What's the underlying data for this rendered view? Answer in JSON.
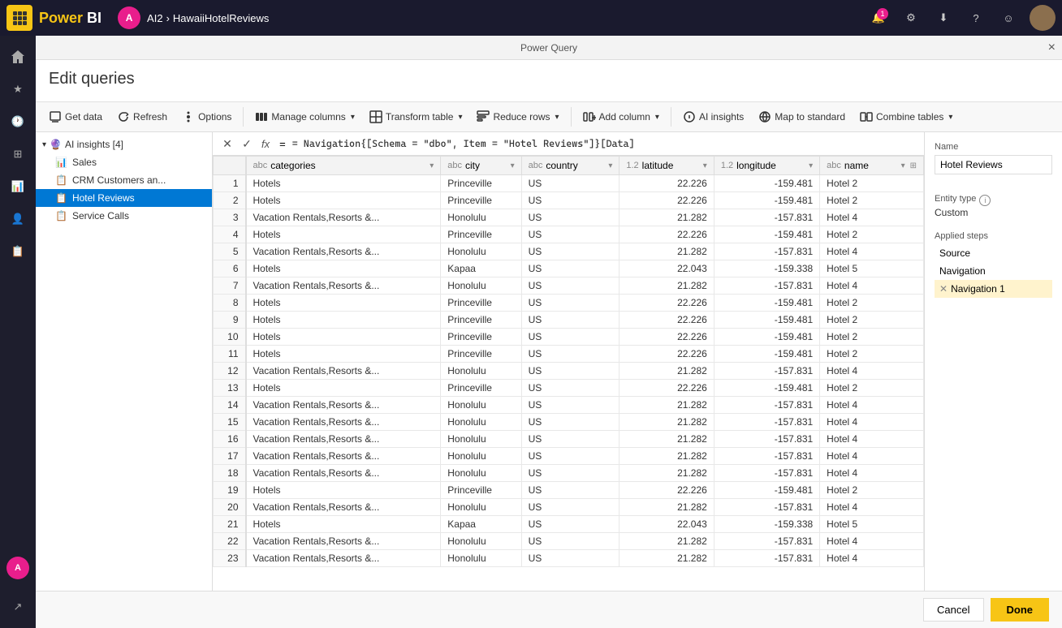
{
  "topbar": {
    "logo": "Power BI",
    "breadcrumb": [
      "A",
      "AI2",
      "HawaiiHotelReviews"
    ],
    "notification_count": "1",
    "dialog_title": "Power Query",
    "close_label": "×"
  },
  "edit_queries": {
    "title": "Edit queries"
  },
  "toolbar": {
    "get_data": "Get data",
    "refresh": "Refresh",
    "options": "Options",
    "manage_columns": "Manage columns",
    "transform_table": "Transform table",
    "reduce_rows": "Reduce rows",
    "add_column": "Add column",
    "ai_insights": "AI insights",
    "map_to_standard": "Map to standard",
    "combine_tables": "Combine tables"
  },
  "queries_panel": {
    "group": {
      "name": "AI insights [4]",
      "items": [
        {
          "label": "Sales",
          "type": "table",
          "active": false
        },
        {
          "label": "CRM Customers an...",
          "type": "table",
          "active": false
        },
        {
          "label": "Hotel Reviews",
          "type": "table",
          "active": true
        },
        {
          "label": "Service Calls",
          "type": "table",
          "active": false
        }
      ]
    }
  },
  "formula_bar": {
    "formula": "= Navigation{[Schema = \"dbo\", Item = \"Hotel Reviews\"]}[Data]"
  },
  "table": {
    "columns": [
      {
        "name": "categories",
        "type": "abc"
      },
      {
        "name": "city",
        "type": "abc"
      },
      {
        "name": "country",
        "type": "abc"
      },
      {
        "name": "latitude",
        "type": "1.2"
      },
      {
        "name": "longitude",
        "type": "1.2"
      },
      {
        "name": "name",
        "type": "abc"
      }
    ],
    "rows": [
      {
        "num": "1",
        "categories": "Hotels",
        "city": "Princeville",
        "country": "US",
        "latitude": "22.226",
        "longitude": "-159.481",
        "name": "Hotel 2"
      },
      {
        "num": "2",
        "categories": "Hotels",
        "city": "Princeville",
        "country": "US",
        "latitude": "22.226",
        "longitude": "-159.481",
        "name": "Hotel 2"
      },
      {
        "num": "3",
        "categories": "Vacation Rentals,Resorts &...",
        "city": "Honolulu",
        "country": "US",
        "latitude": "21.282",
        "longitude": "-157.831",
        "name": "Hotel 4"
      },
      {
        "num": "4",
        "categories": "Hotels",
        "city": "Princeville",
        "country": "US",
        "latitude": "22.226",
        "longitude": "-159.481",
        "name": "Hotel 2"
      },
      {
        "num": "5",
        "categories": "Vacation Rentals,Resorts &...",
        "city": "Honolulu",
        "country": "US",
        "latitude": "21.282",
        "longitude": "-157.831",
        "name": "Hotel 4"
      },
      {
        "num": "6",
        "categories": "Hotels",
        "city": "Kapaa",
        "country": "US",
        "latitude": "22.043",
        "longitude": "-159.338",
        "name": "Hotel 5"
      },
      {
        "num": "7",
        "categories": "Vacation Rentals,Resorts &...",
        "city": "Honolulu",
        "country": "US",
        "latitude": "21.282",
        "longitude": "-157.831",
        "name": "Hotel 4"
      },
      {
        "num": "8",
        "categories": "Hotels",
        "city": "Princeville",
        "country": "US",
        "latitude": "22.226",
        "longitude": "-159.481",
        "name": "Hotel 2"
      },
      {
        "num": "9",
        "categories": "Hotels",
        "city": "Princeville",
        "country": "US",
        "latitude": "22.226",
        "longitude": "-159.481",
        "name": "Hotel 2"
      },
      {
        "num": "10",
        "categories": "Hotels",
        "city": "Princeville",
        "country": "US",
        "latitude": "22.226",
        "longitude": "-159.481",
        "name": "Hotel 2"
      },
      {
        "num": "11",
        "categories": "Hotels",
        "city": "Princeville",
        "country": "US",
        "latitude": "22.226",
        "longitude": "-159.481",
        "name": "Hotel 2"
      },
      {
        "num": "12",
        "categories": "Vacation Rentals,Resorts &...",
        "city": "Honolulu",
        "country": "US",
        "latitude": "21.282",
        "longitude": "-157.831",
        "name": "Hotel 4"
      },
      {
        "num": "13",
        "categories": "Hotels",
        "city": "Princeville",
        "country": "US",
        "latitude": "22.226",
        "longitude": "-159.481",
        "name": "Hotel 2"
      },
      {
        "num": "14",
        "categories": "Vacation Rentals,Resorts &...",
        "city": "Honolulu",
        "country": "US",
        "latitude": "21.282",
        "longitude": "-157.831",
        "name": "Hotel 4"
      },
      {
        "num": "15",
        "categories": "Vacation Rentals,Resorts &...",
        "city": "Honolulu",
        "country": "US",
        "latitude": "21.282",
        "longitude": "-157.831",
        "name": "Hotel 4"
      },
      {
        "num": "16",
        "categories": "Vacation Rentals,Resorts &...",
        "city": "Honolulu",
        "country": "US",
        "latitude": "21.282",
        "longitude": "-157.831",
        "name": "Hotel 4"
      },
      {
        "num": "17",
        "categories": "Vacation Rentals,Resorts &...",
        "city": "Honolulu",
        "country": "US",
        "latitude": "21.282",
        "longitude": "-157.831",
        "name": "Hotel 4"
      },
      {
        "num": "18",
        "categories": "Vacation Rentals,Resorts &...",
        "city": "Honolulu",
        "country": "US",
        "latitude": "21.282",
        "longitude": "-157.831",
        "name": "Hotel 4"
      },
      {
        "num": "19",
        "categories": "Hotels",
        "city": "Princeville",
        "country": "US",
        "latitude": "22.226",
        "longitude": "-159.481",
        "name": "Hotel 2"
      },
      {
        "num": "20",
        "categories": "Vacation Rentals,Resorts &...",
        "city": "Honolulu",
        "country": "US",
        "latitude": "21.282",
        "longitude": "-157.831",
        "name": "Hotel 4"
      },
      {
        "num": "21",
        "categories": "Hotels",
        "city": "Kapaa",
        "country": "US",
        "latitude": "22.043",
        "longitude": "-159.338",
        "name": "Hotel 5"
      },
      {
        "num": "22",
        "categories": "Vacation Rentals,Resorts &...",
        "city": "Honolulu",
        "country": "US",
        "latitude": "21.282",
        "longitude": "-157.831",
        "name": "Hotel 4"
      },
      {
        "num": "23",
        "categories": "Vacation Rentals,Resorts &...",
        "city": "Honolulu",
        "country": "US",
        "latitude": "21.282",
        "longitude": "-157.831",
        "name": "Hotel 4"
      }
    ]
  },
  "right_panel": {
    "name_label": "Name",
    "name_value": "Hotel Reviews",
    "entity_type_label": "Entity type",
    "entity_type_value": "Custom",
    "applied_steps_label": "Applied steps",
    "steps": [
      {
        "label": "Source",
        "deletable": false,
        "active": false
      },
      {
        "label": "Navigation",
        "deletable": false,
        "active": false
      },
      {
        "label": "Navigation 1",
        "deletable": true,
        "active": true
      }
    ]
  },
  "footer": {
    "cancel": "Cancel",
    "done": "Done"
  }
}
